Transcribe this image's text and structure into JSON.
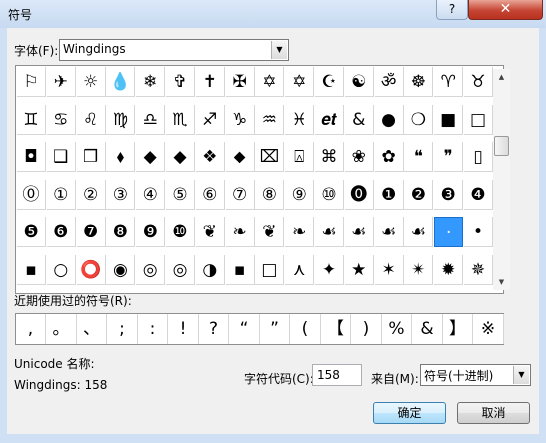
{
  "window": {
    "title": "符号",
    "help_label": "?",
    "close_label": "✕"
  },
  "font": {
    "label": "字体(F):",
    "value": "Wingdings"
  },
  "symbols": [
    "⚐",
    "✈",
    "☼",
    "💧",
    "❄",
    "✞",
    "✝",
    "✠",
    "✡",
    "✡",
    "☪",
    "☯",
    "ॐ",
    "☸",
    "♈",
    "♉",
    "♊",
    "♋",
    "♌",
    "♍",
    "♎",
    "♏",
    "♐",
    "♑",
    "♒",
    "♓",
    "𝒆𝒕",
    "&",
    "●",
    "❍",
    "■",
    "□",
    "◘",
    "❑",
    "❒",
    "⬧",
    "◆",
    "◆",
    "❖",
    "⬥",
    "⌧",
    "⍓",
    "⌘",
    "❀",
    "✿",
    "❝",
    "❞",
    "▯",
    "⓪",
    "①",
    "②",
    "③",
    "④",
    "⑤",
    "⑥",
    "⑦",
    "⑧",
    "⑨",
    "⑩",
    "⓿",
    "❶",
    "❷",
    "❸",
    "❹",
    "❺",
    "❻",
    "❼",
    "❽",
    "❾",
    "❿",
    "❦",
    "❧",
    "❦",
    "❧",
    "☙",
    "☙",
    "☙",
    "☙",
    "·",
    "•",
    "▪",
    "○",
    "⭕",
    "◉",
    "◎",
    "◎",
    "◑",
    "▪",
    "□",
    "⋏",
    "✦",
    "★",
    "✶",
    "✴",
    "✹",
    "✵"
  ],
  "selected_index": 78,
  "recent": {
    "label": "近期使用过的符号(R):",
    "items": [
      ",",
      "。",
      "、",
      ";",
      ":",
      "!",
      "?",
      "“",
      "”",
      "(",
      "【",
      ")",
      "%",
      "&",
      "】",
      "※"
    ]
  },
  "unicode": {
    "name_label": "Unicode 名称:",
    "name_value": "Wingdings: 158"
  },
  "code": {
    "label": "字符代码(C):",
    "value": "158"
  },
  "from": {
    "label": "来自(M):",
    "value": "符号(十进制)"
  },
  "buttons": {
    "ok": "确定",
    "cancel": "取消"
  },
  "scroll": {
    "up": "▲",
    "down": "▼"
  }
}
